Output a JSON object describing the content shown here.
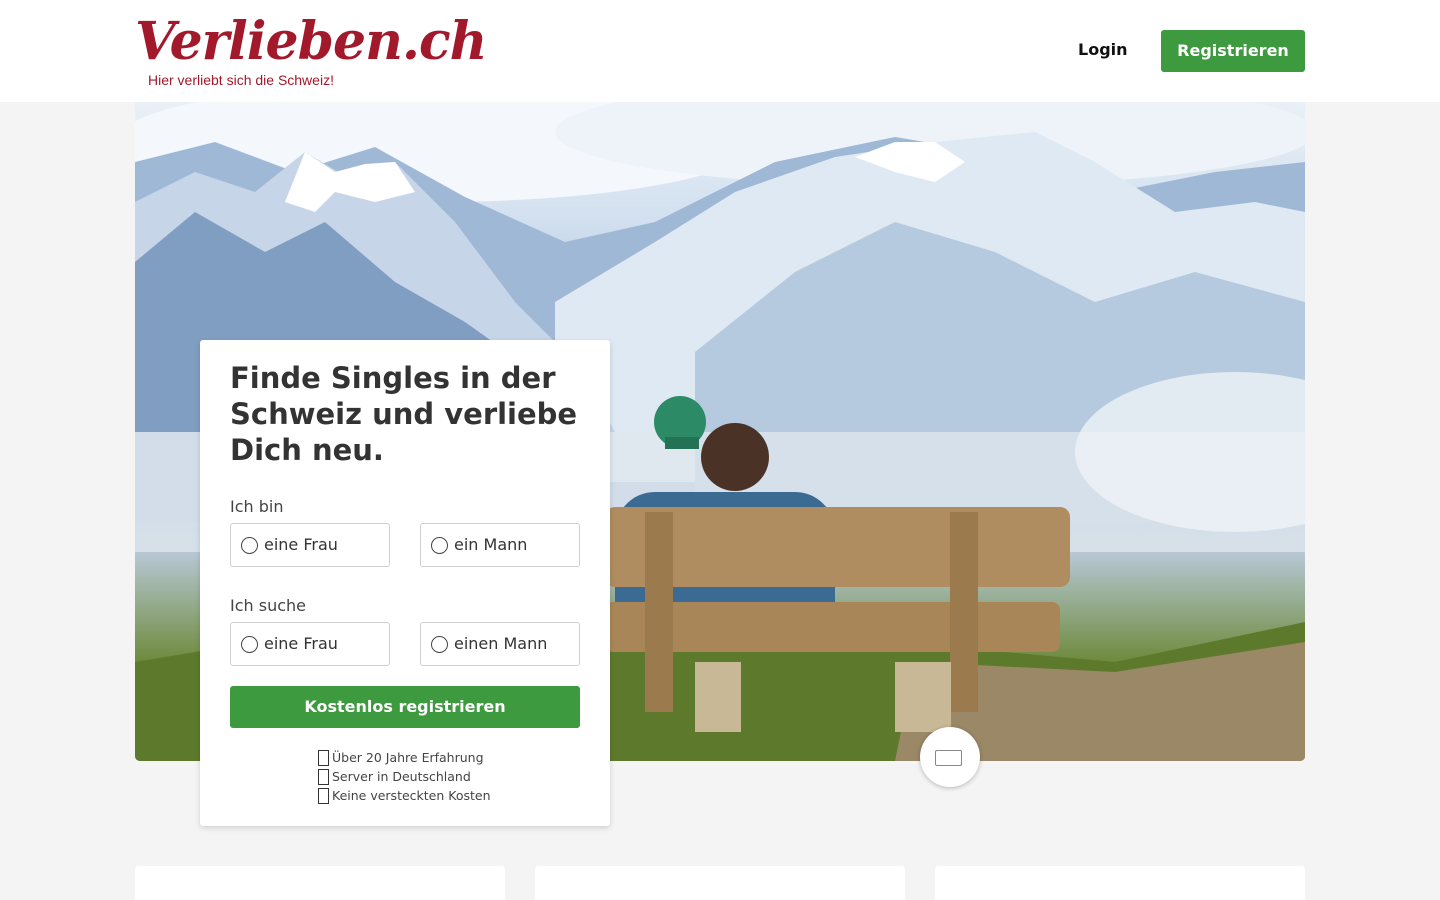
{
  "header": {
    "logo_text": "Verlieben.ch",
    "logo_tagline": "Hier verliebt sich die Schweiz!",
    "login_label": "Login",
    "register_label": "Registrieren"
  },
  "signup": {
    "title": "Finde Singles in der Schweiz und verliebe Dich neu.",
    "iam_label": "Ich bin",
    "iam_options": [
      "eine Frau",
      "ein Mann"
    ],
    "seek_label": "Ich suche",
    "seek_options": [
      "eine Frau",
      "einen Mann"
    ],
    "cta_label": "Kostenlos registrieren",
    "features": [
      "Über 20 Jahre Erfahrung",
      "Server in Deutschland",
      "Keine versteckten Kosten"
    ]
  },
  "colors": {
    "brand_red": "#a3192c",
    "accent_green": "#3d9a3f"
  },
  "icons": {
    "feature": "unknown-glyph-icon",
    "media": "video-play-icon"
  }
}
